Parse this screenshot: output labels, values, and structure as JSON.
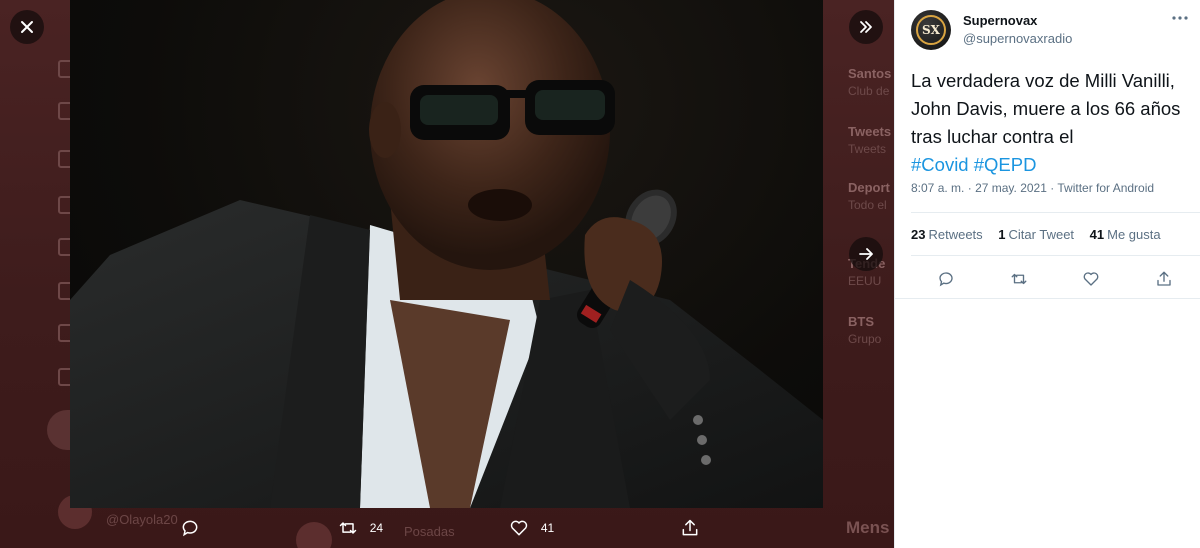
{
  "backdrop": {
    "trends": [
      {
        "title": "Santos",
        "sub": "Club de"
      },
      {
        "title": "Tweets",
        "sub": "Tweets"
      },
      {
        "title": "Deport",
        "sub": "Todo el"
      },
      {
        "title": "Tende",
        "sub": "EEUU"
      },
      {
        "title": "BTS",
        "sub": "Grupo"
      }
    ],
    "feed_user": "@Olayola20",
    "feed_user2": "Posadas",
    "messages_label": "Mens"
  },
  "modal": {
    "close_icon": "close-icon",
    "next_icon": "arrow-right-icon",
    "image_alt": "Singer with sunglasses and microphone",
    "actions": {
      "reply_count": "",
      "retweet_count": "24",
      "like_count": "41"
    }
  },
  "tweet": {
    "author_name": "Supernovax",
    "author_handle": "@supernovaxradio",
    "avatar_text": "SX",
    "text": "La verdadera voz de Milli Vanilli, John Davis, muere a los 66 años tras luchar contra el",
    "hashtags": [
      "#Covid",
      "#QEPD"
    ],
    "time": "8:07 a. m.",
    "date": "27 may. 2021",
    "source": "Twitter for Android",
    "retweets_count": "23",
    "retweets_label": "Retweets",
    "quotes_count": "1",
    "quotes_label": "Citar Tweet",
    "likes_count": "41",
    "likes_label": "Me gusta"
  },
  "colors": {
    "accent": "#1b95e0",
    "text_primary": "#0f1419",
    "text_secondary": "#5b7083",
    "overlay": "#3b1a1a"
  }
}
